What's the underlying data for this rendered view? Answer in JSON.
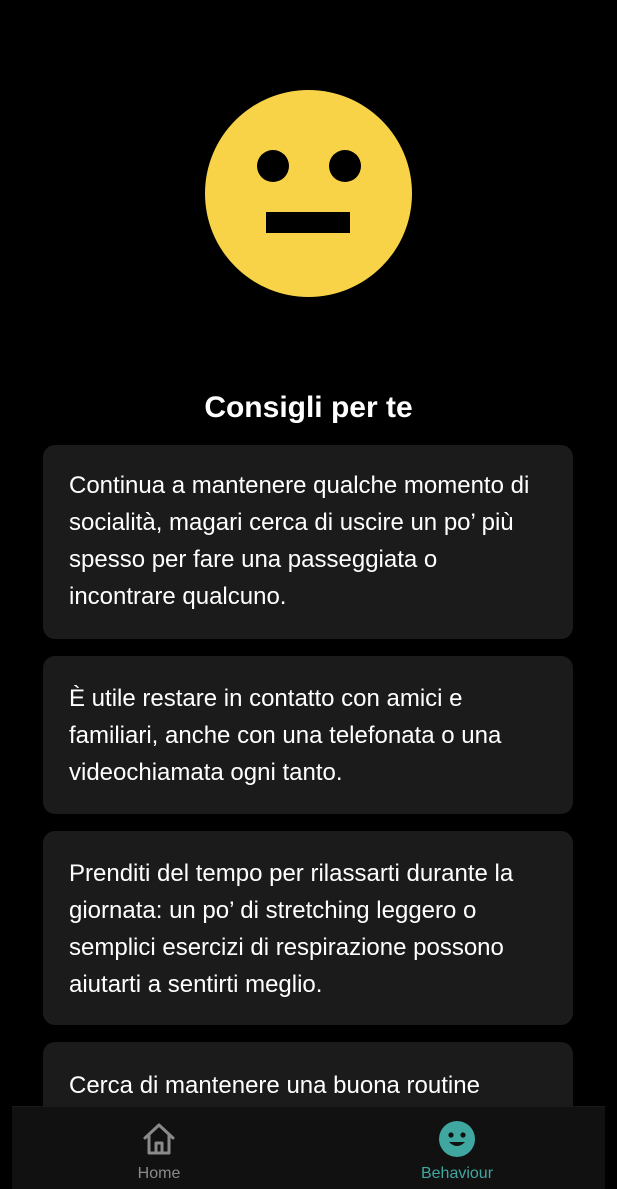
{
  "mood": {
    "icon": "neutral-face-icon",
    "color": "#f8d348"
  },
  "section": {
    "title": "Consigli per te"
  },
  "tips": [
    "Continua a mantenere qualche momento di socialità, magari cerca di uscire un po’ più spesso per fare una passeggiata o incontrare qualcuno.",
    "È utile restare in contatto con amici e familiari, anche con una telefonata o una videochiamata ogni tanto.",
    "Prenditi del tempo per rilassarti durante la giornata: un po’ di stretching leggero o semplici esercizi di respirazione possono aiutarti a sentirti meglio.",
    "Cerca di mantenere una buona routine"
  ],
  "nav": {
    "items": [
      {
        "label": "Home",
        "icon": "home-icon",
        "active": false
      },
      {
        "label": "Behaviour",
        "icon": "smiley-icon",
        "active": true
      }
    ],
    "inactive_color": "#8a8a8a",
    "active_color": "#3fa6a0"
  }
}
